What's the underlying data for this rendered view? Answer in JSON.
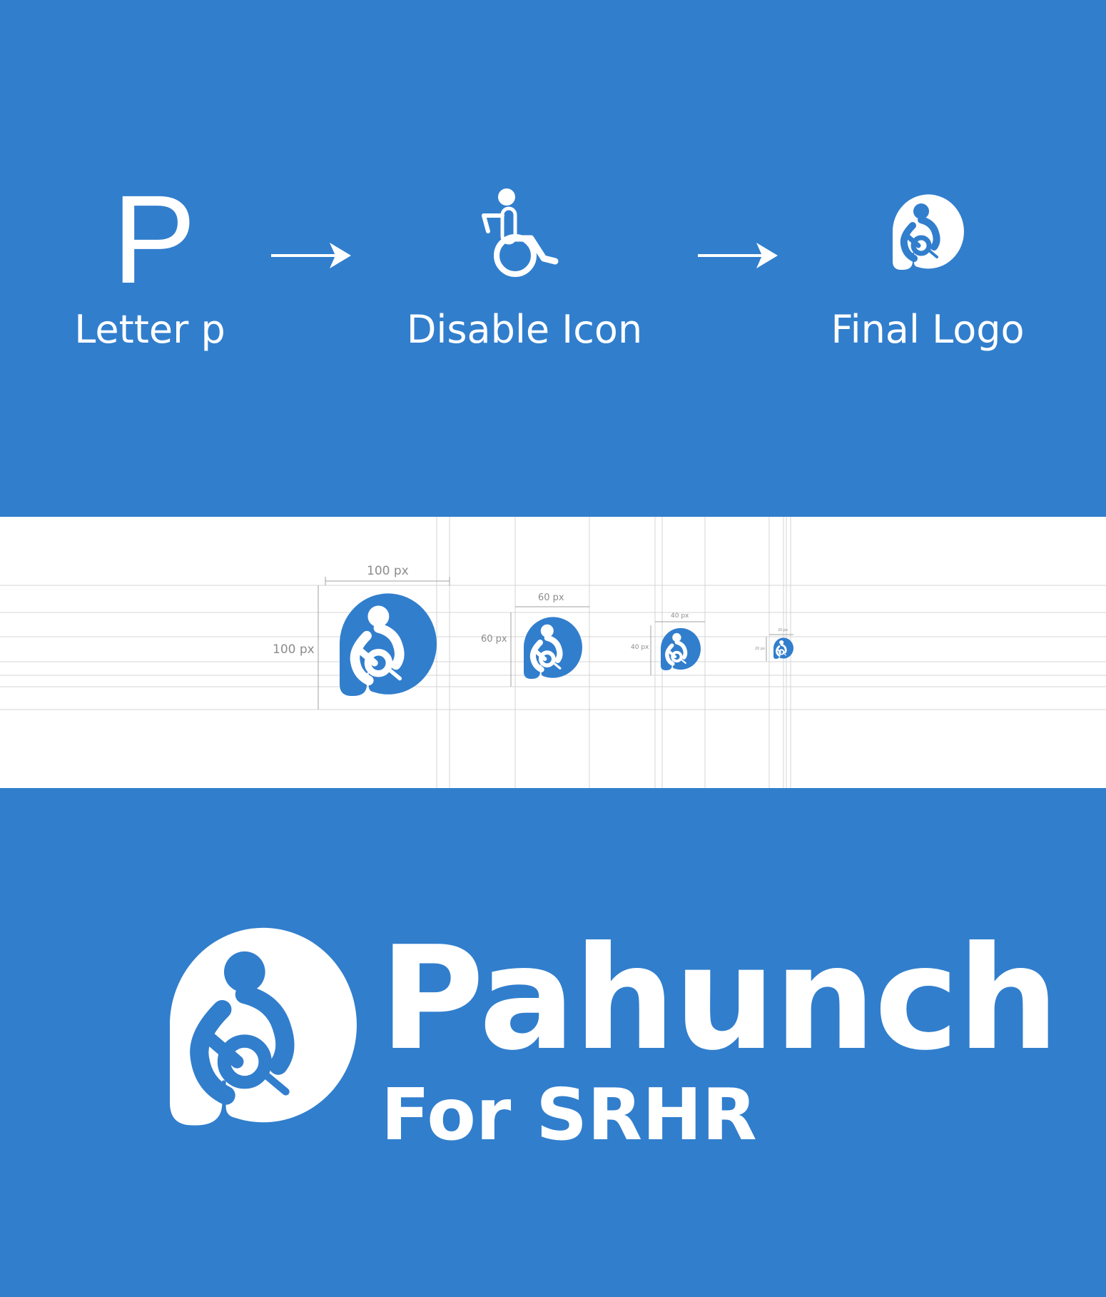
{
  "colors": {
    "brand_blue": "#317ecd",
    "white": "#ffffff",
    "guide_gray": "#cfcfcf",
    "dim_text": "#8c8c8c"
  },
  "process": {
    "letter_glyph": "P",
    "steps": [
      {
        "label": "Letter p",
        "icon": "letter-p"
      },
      {
        "label": "Disable Icon",
        "icon": "wheelchair-icon"
      },
      {
        "label": "Final Logo",
        "icon": "pahunch-logo-icon"
      }
    ],
    "arrow_icon": "arrow-right-icon"
  },
  "sizing": {
    "sizes": [
      {
        "width_label": "100 px",
        "height_label": "100 px"
      },
      {
        "width_label": "60 px",
        "height_label": "60 px"
      },
      {
        "width_label": "40 px",
        "height_label": "40 px"
      },
      {
        "width_label": "20 px",
        "height_label": "20 px"
      }
    ]
  },
  "brand": {
    "name": "Pahunch",
    "tagline": "For SRHR",
    "icon": "pahunch-logo-icon"
  }
}
